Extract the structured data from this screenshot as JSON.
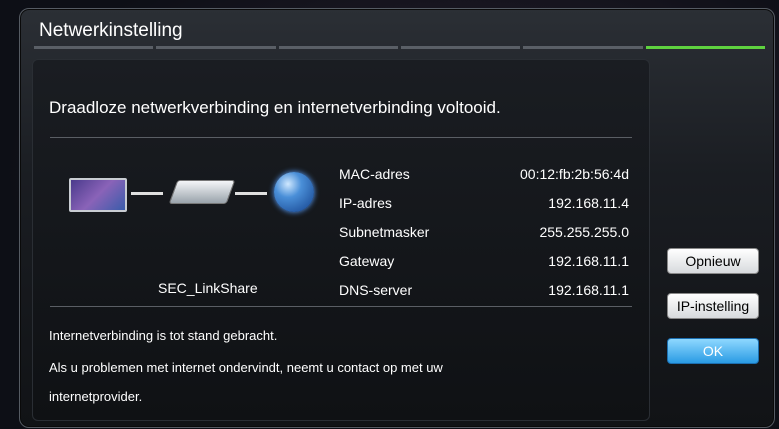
{
  "dialog": {
    "title": "Netwerkinstelling",
    "headline": "Draadloze netwerkverbinding en internetverbinding voltooid.",
    "ssid": "SEC_LinkShare",
    "info": [
      {
        "label": "MAC-adres",
        "value": "00:12:fb:2b:56:4d"
      },
      {
        "label": "IP-adres",
        "value": "192.168.11.4"
      },
      {
        "label": "Subnetmasker",
        "value": "255.255.255.0"
      },
      {
        "label": "Gateway",
        "value": "192.168.11.1"
      },
      {
        "label": "DNS-server",
        "value": "192.168.11.1"
      }
    ],
    "messages": [
      "Internetverbinding is tot stand gebracht.",
      "Als u problemen met internet ondervindt, neemt u contact op met uw",
      "internetprovider."
    ]
  },
  "buttons": {
    "retry": "Opnieuw",
    "ip_settings": "IP-instelling",
    "ok": "OK"
  },
  "steps": {
    "count": 6,
    "active_index": 5
  },
  "colors": {
    "progress_active": "#5fd23f",
    "ok_button": "#2a9be4"
  },
  "icons": [
    "tv-icon",
    "router-icon",
    "globe-icon"
  ]
}
